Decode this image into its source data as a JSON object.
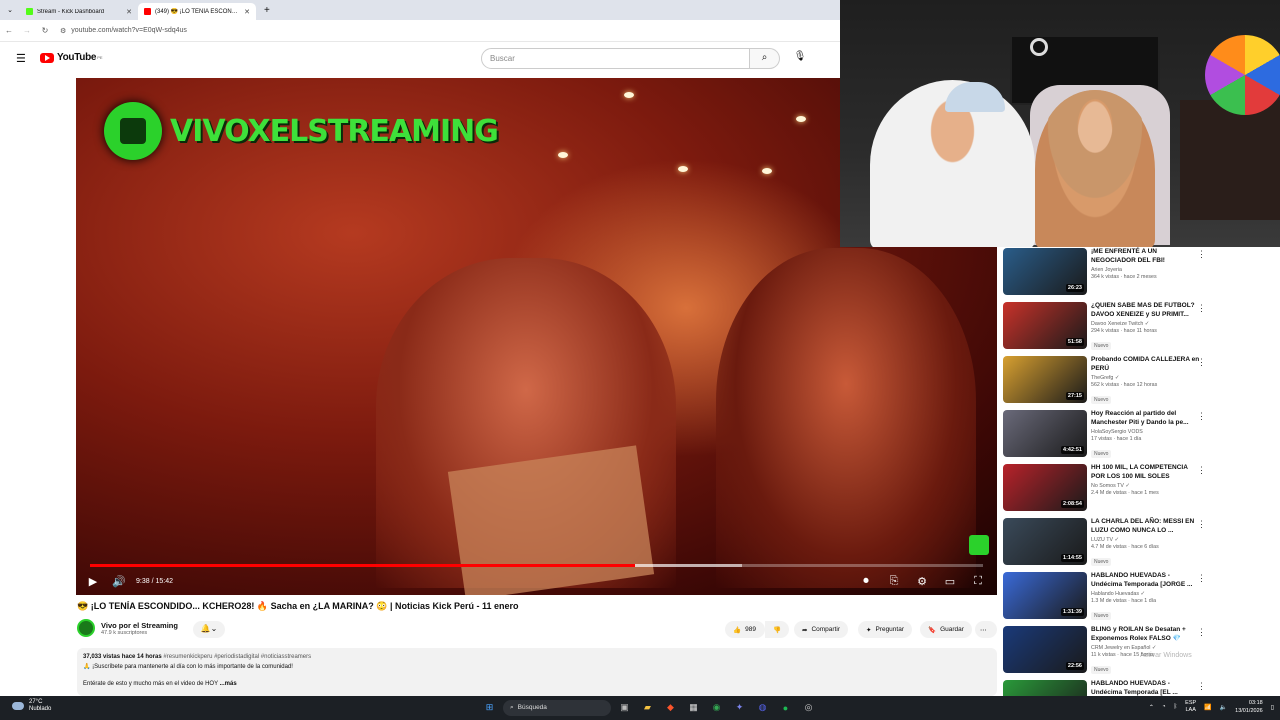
{
  "browser": {
    "tabs": [
      {
        "title": "Stream - Kick Dashboard",
        "favicon_color": "#53fc18",
        "active": false
      },
      {
        "title": "(349) 😎 ¡LO TENÍA ESCONDIDO...",
        "favicon_color": "#ff0000",
        "active": true
      }
    ],
    "url": "youtube.com/watch?v=E0qW-sdq4us"
  },
  "youtube": {
    "logo_text": "YouTube",
    "logo_sup": "PE",
    "search_placeholder": "Buscar"
  },
  "player": {
    "watermark": "VIVOXELSTREAMING",
    "time": "9:38 / 15:42",
    "progress_fraction": 0.61,
    "buffered_fraction": 0.73
  },
  "video": {
    "title": "😎 ¡LO TENÍA ESCONDIDO... KCHERO28! 🔥 Sacha en ¿LA MARINA? 😳 | Noticias Kick Perú - 11 enero",
    "channel": "Vivo por el Streaming",
    "subscribers": "47.9 k suscriptores",
    "likes": "989",
    "share_label": "Compartir",
    "ask_label": "Preguntar",
    "save_label": "Guardar",
    "views": "37,033 vistas",
    "age": "hace 14 horas",
    "tags": "#resumenkickperu #periodistadigital #noticiasstreamers",
    "desc_line1": "🙏 ¡Suscríbete para mantenerte al día con lo más importante de la comunidad!",
    "desc_line2": "Entérate de esto y mucho más en el video de HOY",
    "more": "...más"
  },
  "sidebar": {
    "items": [
      {
        "title": "¡ME ENFRENTÉ A UN NEGOCIADOR DEL FBI!",
        "channel": "Arien Joyeria",
        "meta": "364 k vistas · hace 2 meses",
        "duration": "26:23",
        "is_new": false,
        "thumb": "#2a5d8a"
      },
      {
        "title": "¿QUIEN SABE MAS DE FUTBOL? DAVOO XENEIZE y SU PRIMIT...",
        "channel": "Davoo Xeneize Twitch ✓",
        "meta": "294 k vistas · hace 11 horas",
        "duration": "51:58",
        "is_new": true,
        "thumb": "#c8322a"
      },
      {
        "title": "Probando COMIDA CALLEJERA en PERÚ",
        "channel": "TheGrefg ✓",
        "meta": "562 k vistas · hace 12 horas",
        "duration": "27:15",
        "is_new": true,
        "thumb": "#d8a030"
      },
      {
        "title": "Hoy Reacción al partido del Manchester Piti y Dando la pe...",
        "channel": "HolaSoySergio VODS",
        "meta": "17 vistas · hace 1 día",
        "duration": "4:42:51",
        "is_new": true,
        "thumb": "#6a6a7a"
      },
      {
        "title": "HH 100 MIL, LA COMPETENCIA POR LOS 100 MIL SOLES",
        "channel": "No Somos TV ✓",
        "meta": "2.4 M de vistas · hace 1 mes",
        "duration": "2:08:54",
        "is_new": false,
        "thumb": "#b8222a"
      },
      {
        "title": "LA CHARLA DEL AÑO: MESSI EN LUZU COMO NUNCA LO ...",
        "channel": "LUZU TV ✓",
        "meta": "4.7 M de vistas · hace 6 días",
        "duration": "1:14:55",
        "is_new": true,
        "thumb": "#3a4a5a"
      },
      {
        "title": "HABLANDO HUEVADAS - Undécima Temporada [JORGE ...",
        "channel": "Hablando Huevadas ✓",
        "meta": "1.3 M de vistas · hace 1 día",
        "duration": "1:31:39",
        "is_new": true,
        "thumb": "#3a6ad8"
      },
      {
        "title": "BLING y ROILAN Se Desatan + Exponemos Rolex FALSO 💎",
        "channel": "CRM Jewelry en Español ✓",
        "meta": "11 k vistas · hace 15 horas",
        "duration": "22:56",
        "is_new": true,
        "thumb": "#1a3a7a"
      },
      {
        "title": "HABLANDO HUEVADAS - Undécima Temporada [EL ...",
        "channel": "",
        "meta": "",
        "duration": "",
        "is_new": false,
        "thumb": "#2a9a3a"
      }
    ],
    "new_label": "Nuevo"
  },
  "windows_watermark": "Activar Windows",
  "taskbar": {
    "temp": "27°C",
    "weather": "Nublado",
    "search": "Búsqueda",
    "lang1": "ESP",
    "lang2": "LAA",
    "time": "03:18",
    "date": "13/01/2026"
  }
}
